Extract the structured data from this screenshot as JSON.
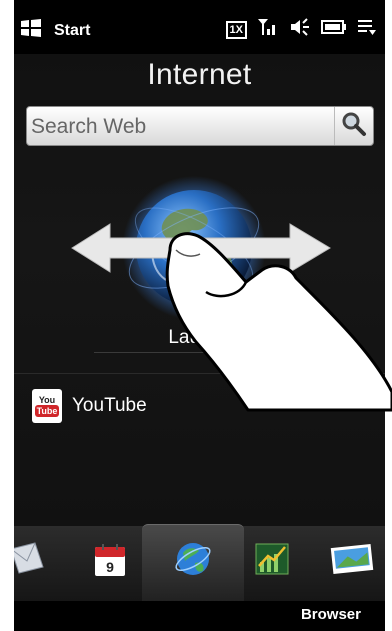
{
  "status_bar": {
    "start_label": "Start",
    "network_label": "1X",
    "icons": [
      "windows-flag-icon",
      "signal-icon",
      "speaker-icon",
      "battery-icon",
      "menu-icon"
    ]
  },
  "page": {
    "title": "Internet"
  },
  "search": {
    "placeholder": "Search Web",
    "icon": "magnifier-icon"
  },
  "hero": {
    "launch_label": "Launch"
  },
  "items": [
    {
      "label": "YouTube",
      "icon_top": "You",
      "icon_bottom": "Tube"
    }
  ],
  "tabs": {
    "active_label": "Browser",
    "calendar_day": "9",
    "icons": [
      "mail-icon",
      "calendar-icon",
      "browser-globe-icon",
      "stocks-icon",
      "photos-icon"
    ]
  },
  "colors": {
    "accent_red": "#d0262a",
    "background": "#000000"
  }
}
